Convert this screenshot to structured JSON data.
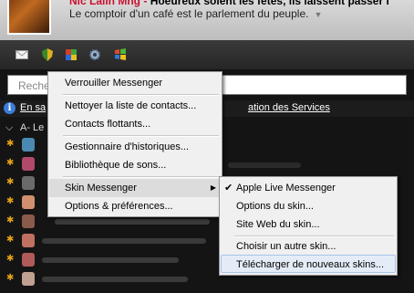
{
  "profile": {
    "name_visible": "Hoeureux soient les fêtes, ils laissent passer l",
    "name_prefix": "Nic Lalln Mng -",
    "personal_message": "Le comptoir d'un café est le parlement du peuple.",
    "colors": {
      "name_prefix": "#c8102e"
    }
  },
  "toolbar": {
    "icons": [
      "mail-icon",
      "shield-icon",
      "shield-icon-2",
      "gear-icon",
      "windows-icon"
    ]
  },
  "search": {
    "placeholder": "Reche"
  },
  "info_bar": {
    "link_left": "En sa",
    "link_right": "ation des Services"
  },
  "contacts_group_label": "A- Le",
  "main_menu": {
    "items": [
      {
        "label": "Verrouiller Messenger"
      },
      {
        "label": "Nettoyer la liste de contacts..."
      },
      {
        "label": "Contacts flottants..."
      },
      {
        "label": "Gestionnaire d'historiques..."
      },
      {
        "label": "Bibliothèque de sons..."
      },
      {
        "label": "Skin Messenger"
      },
      {
        "label": "Options & préférences..."
      }
    ]
  },
  "skin_submenu": {
    "items": [
      {
        "label": "Apple Live Messenger",
        "checked": "✔"
      },
      {
        "label": "Options du skin..."
      },
      {
        "label": "Site Web du skin..."
      },
      {
        "label": "Choisir un autre skin..."
      },
      {
        "label": "Télécharger de nouveaux skins..."
      }
    ]
  }
}
